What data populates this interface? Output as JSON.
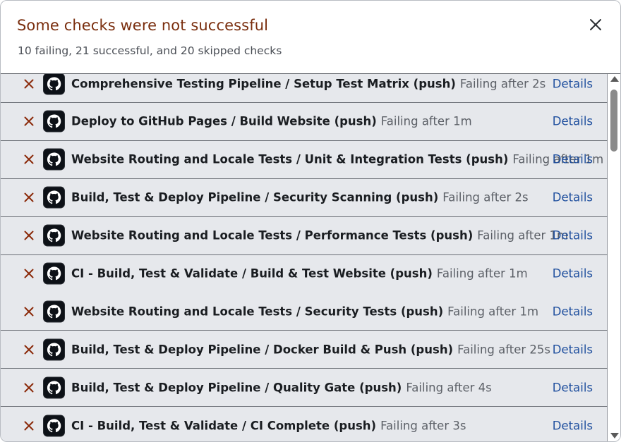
{
  "dialog": {
    "title": "Some checks were not successful",
    "subtitle": "10 failing, 21 successful, and 20 skipped checks",
    "close_icon": "close-icon"
  },
  "checks": [
    {
      "name": "Comprehensive Testing Pipeline / Setup Test Matrix (push)",
      "status": "Failing after 2s",
      "link": "Details"
    },
    {
      "name": "Deploy to GitHub Pages / Build Website (push)",
      "status": "Failing after 1m",
      "link": "Details"
    },
    {
      "name": "Website Routing and Locale Tests / Unit & Integration Tests (push)",
      "status": "Failing after 1m",
      "link": "Details"
    },
    {
      "name": "Build, Test & Deploy Pipeline / Security Scanning (push)",
      "status": "Failing after 2s",
      "link": "Details"
    },
    {
      "name": "Website Routing and Locale Tests / Performance Tests (push)",
      "status": "Failing after 1m",
      "link": "Details"
    },
    {
      "name": "CI - Build, Test & Validate / Build & Test Website (push)",
      "status": "Failing after 1m",
      "link": "Details"
    },
    {
      "name": "Website Routing and Locale Tests / Security Tests (push)",
      "status": "Failing after 1m",
      "link": "Details"
    },
    {
      "name": "Build, Test & Deploy Pipeline / Docker Build & Push (push)",
      "status": "Failing after 25s",
      "link": "Details"
    },
    {
      "name": "Build, Test & Deploy Pipeline / Quality Gate (push)",
      "status": "Failing after 4s",
      "link": "Details"
    },
    {
      "name": "CI - Build, Test & Validate / CI Complete (push)",
      "status": "Failing after 3s",
      "link": "Details"
    }
  ],
  "icons": {
    "fail": "x-icon",
    "app": "github-icon"
  },
  "colors": {
    "title": "#7a2e0e",
    "fail_x": "#8b2a0a",
    "link": "#1f4f9e",
    "row_bg": "#e6e8ec"
  }
}
